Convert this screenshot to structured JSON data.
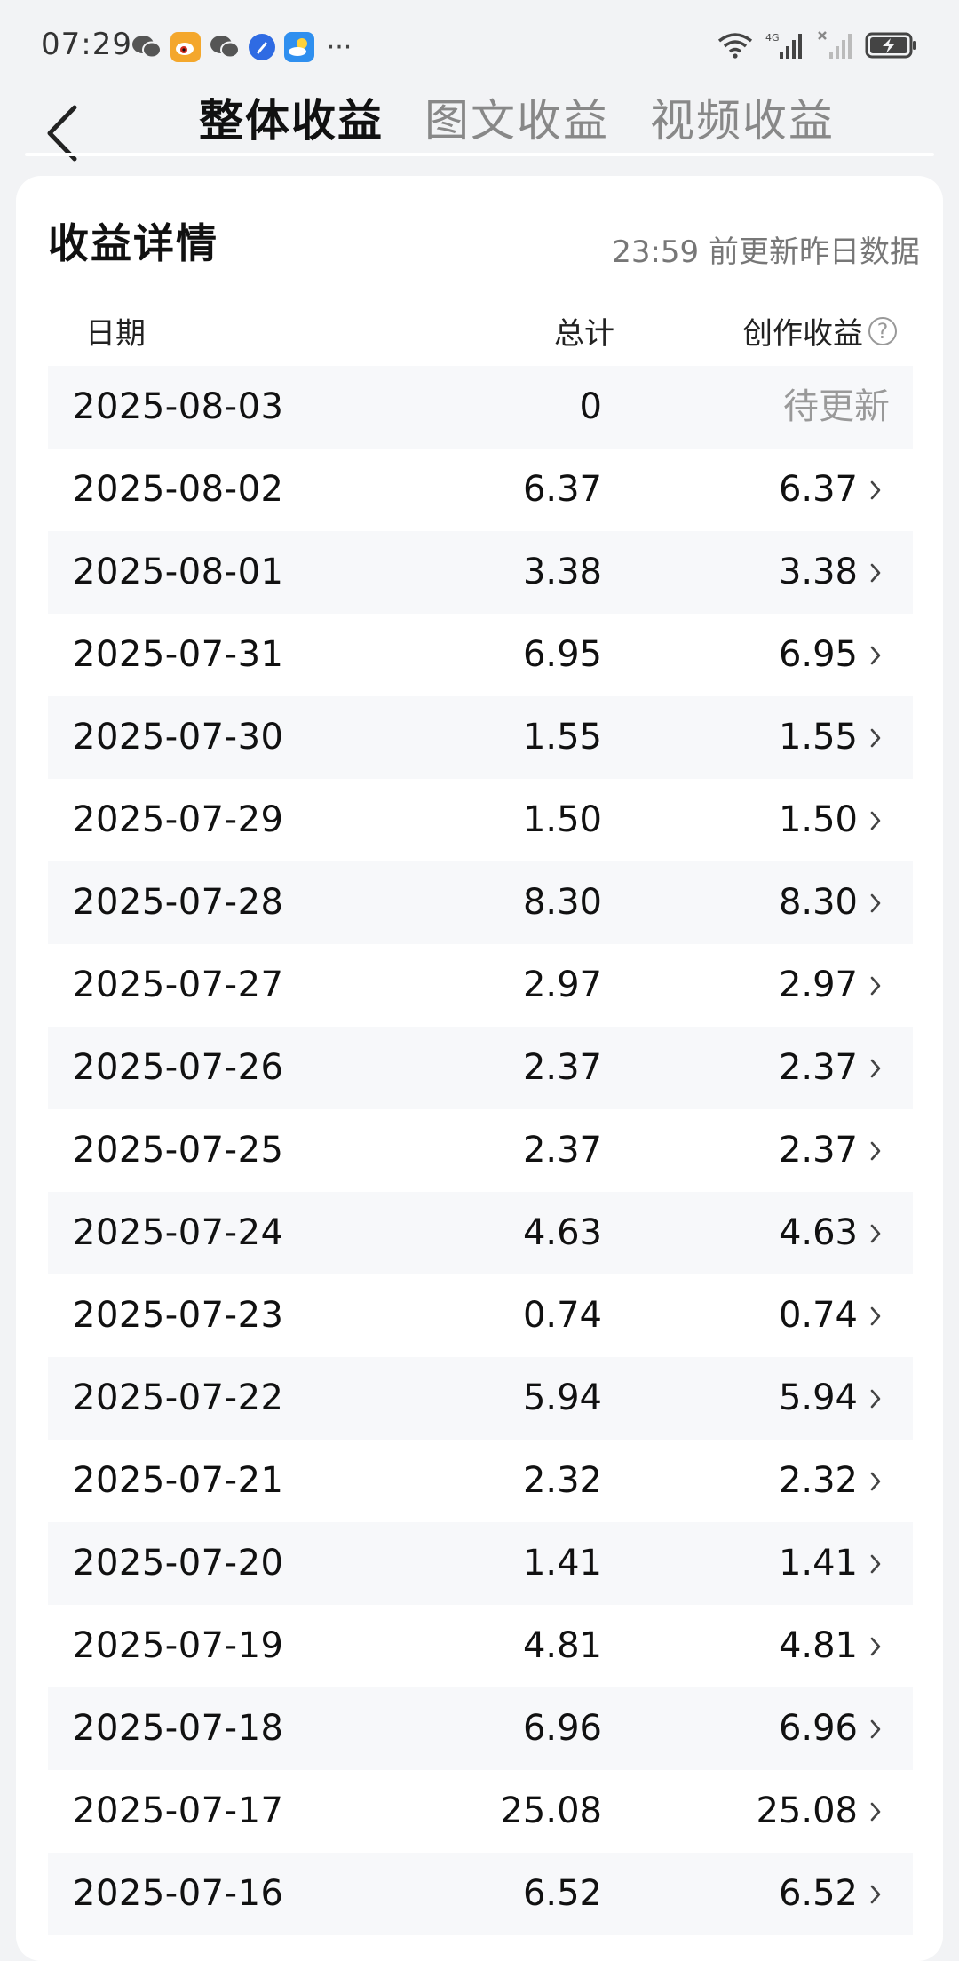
{
  "status_bar": {
    "time": "07:29",
    "notification_icons": [
      "wechat-icon",
      "weibo-icon",
      "wechat-icon",
      "browser-icon",
      "weather-icon"
    ],
    "more": "···",
    "network_label": "4G"
  },
  "nav": {
    "tabs": [
      {
        "label": "整体收益",
        "active": true
      },
      {
        "label": "图文收益",
        "active": false
      },
      {
        "label": "视频收益",
        "active": false
      }
    ]
  },
  "card": {
    "title": "收益详情",
    "note": "23:59 前更新昨日数据",
    "headers": {
      "date": "日期",
      "total": "总计",
      "create": "创作收益"
    },
    "help_symbol": "?",
    "rows": [
      {
        "date": "2025-08-03",
        "total": "0",
        "create": "待更新",
        "pending": true
      },
      {
        "date": "2025-08-02",
        "total": "6.37",
        "create": "6.37",
        "pending": false
      },
      {
        "date": "2025-08-01",
        "total": "3.38",
        "create": "3.38",
        "pending": false
      },
      {
        "date": "2025-07-31",
        "total": "6.95",
        "create": "6.95",
        "pending": false
      },
      {
        "date": "2025-07-30",
        "total": "1.55",
        "create": "1.55",
        "pending": false
      },
      {
        "date": "2025-07-29",
        "total": "1.50",
        "create": "1.50",
        "pending": false
      },
      {
        "date": "2025-07-28",
        "total": "8.30",
        "create": "8.30",
        "pending": false
      },
      {
        "date": "2025-07-27",
        "total": "2.97",
        "create": "2.97",
        "pending": false
      },
      {
        "date": "2025-07-26",
        "total": "2.37",
        "create": "2.37",
        "pending": false
      },
      {
        "date": "2025-07-25",
        "total": "2.37",
        "create": "2.37",
        "pending": false
      },
      {
        "date": "2025-07-24",
        "total": "4.63",
        "create": "4.63",
        "pending": false
      },
      {
        "date": "2025-07-23",
        "total": "0.74",
        "create": "0.74",
        "pending": false
      },
      {
        "date": "2025-07-22",
        "total": "5.94",
        "create": "5.94",
        "pending": false
      },
      {
        "date": "2025-07-21",
        "total": "2.32",
        "create": "2.32",
        "pending": false
      },
      {
        "date": "2025-07-20",
        "total": "1.41",
        "create": "1.41",
        "pending": false
      },
      {
        "date": "2025-07-19",
        "total": "4.81",
        "create": "4.81",
        "pending": false
      },
      {
        "date": "2025-07-18",
        "total": "6.96",
        "create": "6.96",
        "pending": false
      },
      {
        "date": "2025-07-17",
        "total": "25.08",
        "create": "25.08",
        "pending": false
      },
      {
        "date": "2025-07-16",
        "total": "6.52",
        "create": "6.52",
        "pending": false
      }
    ]
  },
  "colors": {
    "page_bg": "#f2f3f5",
    "card_bg": "#ffffff",
    "stripe": "#f7f8fa",
    "muted_text": "#999999"
  }
}
